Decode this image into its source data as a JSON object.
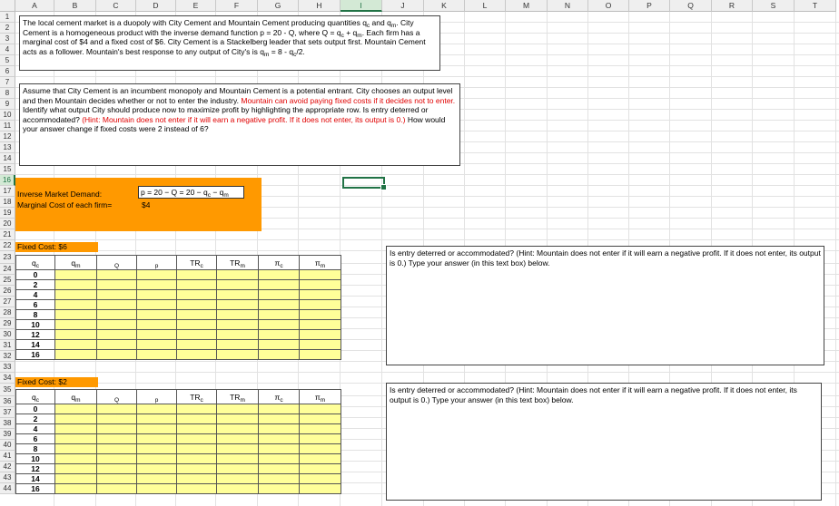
{
  "columns": [
    "A",
    "B",
    "C",
    "D",
    "E",
    "F",
    "G",
    "H",
    "I",
    "J",
    "K",
    "L",
    "M",
    "N",
    "O",
    "P",
    "Q",
    "R",
    "S",
    "T"
  ],
  "selected_column": "I",
  "selected_row": "16",
  "rows": [
    "1",
    "2",
    "3",
    "4",
    "5",
    "6",
    "7",
    "8",
    "9",
    "10",
    "11",
    "12",
    "13",
    "14",
    "15",
    "16",
    "17",
    "18",
    "19",
    "20",
    "21",
    "22",
    "23",
    "24",
    "25",
    "26",
    "27",
    "28",
    "29",
    "30",
    "31",
    "32",
    "33",
    "34",
    "35",
    "36",
    "37",
    "38",
    "39",
    "40",
    "41",
    "42",
    "43",
    "44"
  ],
  "intro_box": {
    "p1_a": "The local cement market is a duopoly with City Cement and Mountain Cement producing quantities q",
    "p1_sub_c": "c",
    "p1_b": " and q",
    "p1_sub_m": "m",
    "p1_c": ". City Cement is a homogeneous product with the inverse demand function p = 20 - Q, where Q = q",
    "p1_d": " + q",
    "p1_e": ". Each firm has a marginal cost of $4 and a fixed cost of $6. City Cement is a Stackelberg leader that sets output first. Mountain Cement acts as a follower. Mountain's best response to any output of City's is q",
    "p1_f": " = 8 - q",
    "p1_g": "/2."
  },
  "question_box": {
    "part1": "Assume that City Cement is an incumbent monopoly and Mountain Cement is a potential entrant. City chooses an output level and then Mountain decides whether or not to enter the industry. ",
    "part2_red": "Mountain can avoid paying fixed costs if it decides not to enter.",
    "part3": " Identify what output City should produce now to maximize profit by highlighting the appropriate row. Is entry deterred or accommodated? ",
    "part4_red": "(Hint: Mountain does not enter if it will earn a negative profit. If it does not enter, its output is 0.)",
    "part5": " How would your answer change if fixed costs were 2 instead of 6?"
  },
  "inputs": {
    "demand_label": "Inverse Market Demand:",
    "demand_formula": "p = 20 − Q = 20 − q",
    "demand_formula_sub_c": "c",
    "demand_formula_mid": " − q",
    "demand_formula_sub_m": "m",
    "mc_label": "Marginal Cost of each firm=",
    "mc_value": "$4"
  },
  "table1": {
    "fixed_cost_label": "Fixed Cost: $6",
    "headers": [
      "qc",
      "qm",
      "Q",
      "p",
      "TRc",
      "TRm",
      "πc",
      "πm"
    ],
    "qc_values": [
      "0",
      "2",
      "4",
      "6",
      "8",
      "10",
      "12",
      "14",
      "16"
    ]
  },
  "table2": {
    "fixed_cost_label": "Fixed Cost: $2",
    "headers": [
      "qc",
      "qm",
      "Q",
      "p",
      "TRc",
      "TRm",
      "πc",
      "πm"
    ],
    "qc_values": [
      "0",
      "2",
      "4",
      "6",
      "8",
      "10",
      "12",
      "14",
      "16"
    ]
  },
  "answer_box1": {
    "text": "Is entry deterred or accommodated? (Hint: Mountain does not enter if it will earn a negative profit. If it does not enter, its output is 0.) Type your answer (in this text box) below."
  },
  "answer_box2": {
    "text": "Is entry deterred or accommodated? (Hint: Mountain does not enter if it will earn a negative profit. If it does not enter, its output is 0.) Type your answer (in this text box) below."
  },
  "colors": {
    "orange": "#ff9900",
    "input_yellow": "#ffff99",
    "hint_red": "#e00000",
    "selection_green": "#217346"
  }
}
